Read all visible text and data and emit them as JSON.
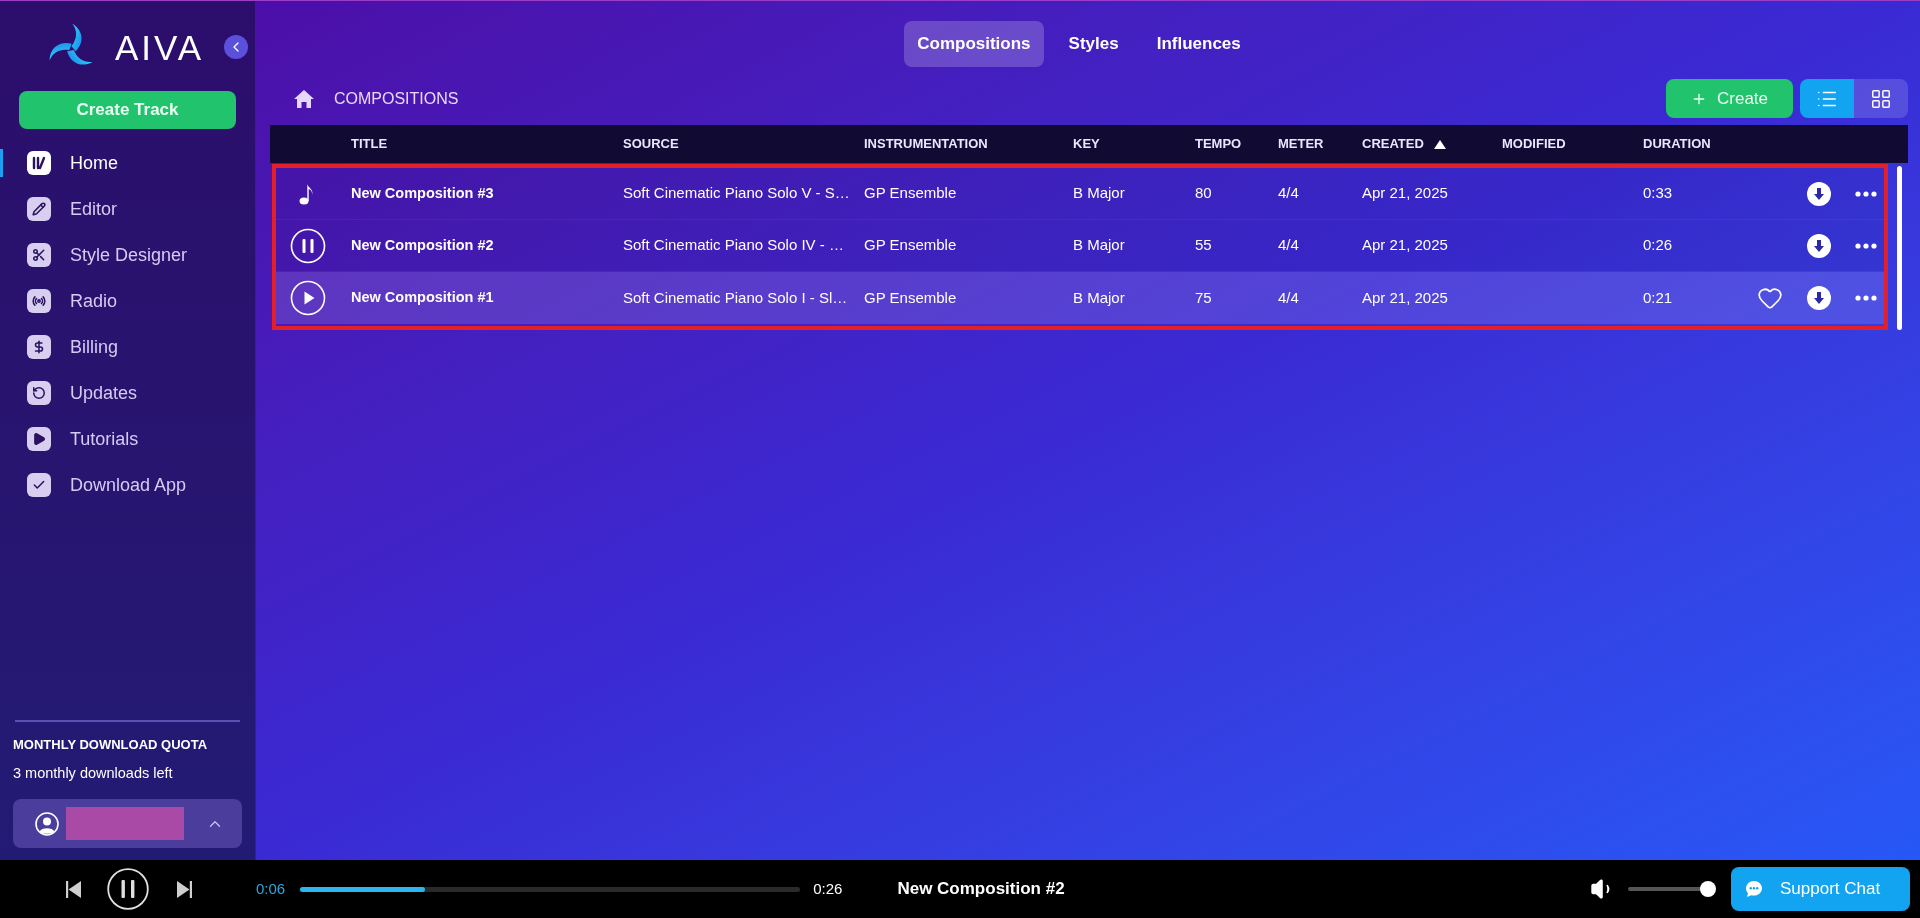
{
  "app": {
    "name": "AIVA"
  },
  "sidebar": {
    "create_button": "Create Track",
    "items": [
      {
        "label": "Home",
        "selected": true
      },
      {
        "label": "Editor",
        "selected": false
      },
      {
        "label": "Style Designer",
        "selected": false
      },
      {
        "label": "Radio",
        "selected": false
      },
      {
        "label": "Billing",
        "selected": false
      },
      {
        "label": "Updates",
        "selected": false
      },
      {
        "label": "Tutorials",
        "selected": false
      },
      {
        "label": "Download App",
        "selected": false
      }
    ],
    "quota": {
      "title": "MONTHLY DOWNLOAD QUOTA",
      "text": "3 monthly downloads left"
    }
  },
  "tabs": [
    {
      "label": "Compositions",
      "selected": true
    },
    {
      "label": "Styles",
      "selected": false
    },
    {
      "label": "Influences",
      "selected": false
    }
  ],
  "breadcrumb": "COMPOSITIONS",
  "create_button": "Create",
  "view_toggle": [
    {
      "kind": "list",
      "selected": true
    },
    {
      "kind": "grid",
      "selected": false
    }
  ],
  "table": {
    "columns": [
      {
        "label": "TITLE",
        "sorted": false
      },
      {
        "label": "SOURCE",
        "sorted": false
      },
      {
        "label": "INSTRUMENTATION",
        "sorted": false
      },
      {
        "label": "KEY",
        "sorted": false
      },
      {
        "label": "TEMPO",
        "sorted": false
      },
      {
        "label": "METER",
        "sorted": false
      },
      {
        "label": "CREATED",
        "sorted": true
      },
      {
        "label": "MODIFIED",
        "sorted": false
      },
      {
        "label": "DURATION",
        "sorted": false
      }
    ],
    "rows": [
      {
        "title": "New Composition #3",
        "source": "Soft Cinematic Piano Solo V - S…",
        "instrumentation": "GP Ensemble",
        "key": "B Major",
        "tempo": "80",
        "meter": "4/4",
        "created": "Apr 21, 2025",
        "duration": "0:33",
        "playing": false,
        "hovered": false
      },
      {
        "title": "New Composition #2",
        "source": "Soft Cinematic Piano Solo IV - …",
        "instrumentation": "GP Ensemble",
        "key": "B Major",
        "tempo": "55",
        "meter": "4/4",
        "created": "Apr 21, 2025",
        "duration": "0:26",
        "playing": true,
        "hovered": false
      },
      {
        "title": "New Composition #1",
        "source": "Soft Cinematic Piano Solo I - Sl…",
        "instrumentation": "GP Ensemble",
        "key": "B Major",
        "tempo": "75",
        "meter": "4/4",
        "created": "Apr 21, 2025",
        "duration": "0:21",
        "playing": false,
        "hovered": true
      }
    ]
  },
  "player": {
    "playing": true,
    "current": "0:06",
    "total": "0:26",
    "progress": {
      "level": 0.25
    },
    "title": "New Composition #2",
    "volume": {
      "level": 0.93
    }
  },
  "support_button": "Support Chat"
}
